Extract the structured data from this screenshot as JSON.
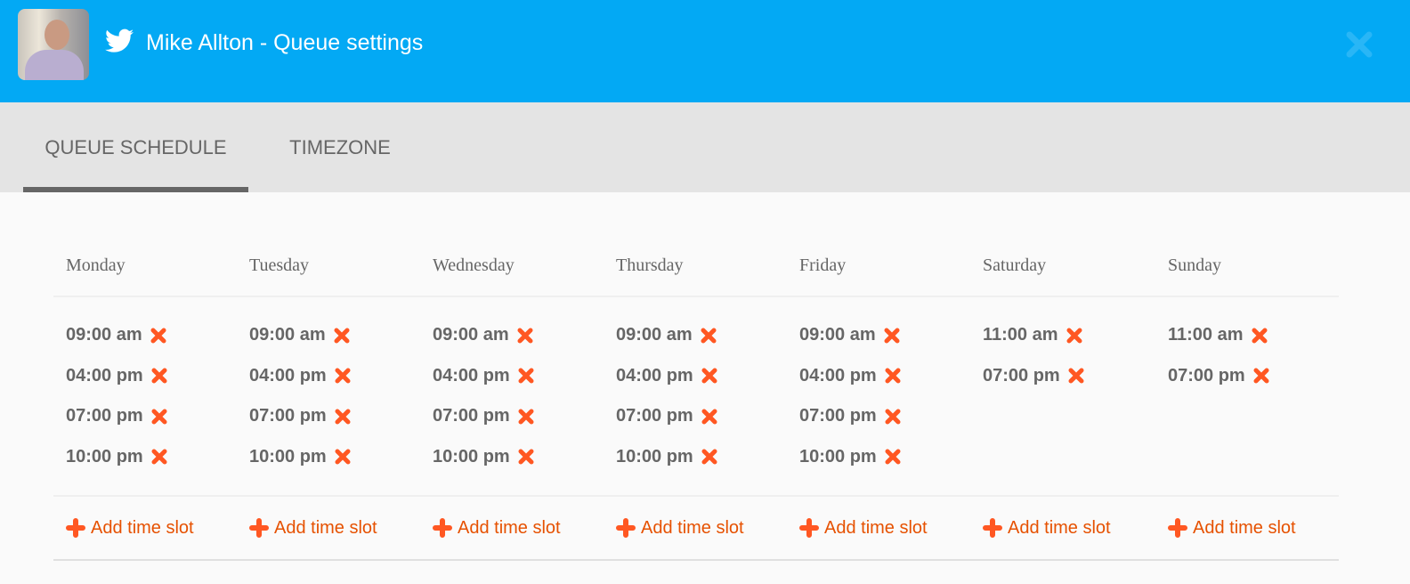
{
  "header": {
    "title": "Mike Allton - Queue settings",
    "icons": {
      "network": "twitter-bird-icon",
      "close": "close-icon"
    },
    "colors": {
      "bg": "#03a9f4"
    }
  },
  "tabs": [
    {
      "label": "QUEUE SCHEDULE",
      "active": true
    },
    {
      "label": "TIMEZONE",
      "active": false
    }
  ],
  "schedule": {
    "days": [
      {
        "name": "Monday",
        "slots": [
          "09:00 am",
          "04:00 pm",
          "07:00 pm",
          "10:00 pm"
        ]
      },
      {
        "name": "Tuesday",
        "slots": [
          "09:00 am",
          "04:00 pm",
          "07:00 pm",
          "10:00 pm"
        ]
      },
      {
        "name": "Wednesday",
        "slots": [
          "09:00 am",
          "04:00 pm",
          "07:00 pm",
          "10:00 pm"
        ]
      },
      {
        "name": "Thursday",
        "slots": [
          "09:00 am",
          "04:00 pm",
          "07:00 pm",
          "10:00 pm"
        ]
      },
      {
        "name": "Friday",
        "slots": [
          "09:00 am",
          "04:00 pm",
          "07:00 pm",
          "10:00 pm"
        ]
      },
      {
        "name": "Saturday",
        "slots": [
          "11:00 am",
          "07:00 pm"
        ]
      },
      {
        "name": "Sunday",
        "slots": [
          "11:00 am",
          "07:00 pm"
        ]
      }
    ],
    "add_label": "Add time slot",
    "colors": {
      "accent": "#ff5722",
      "add_text": "#e65100"
    }
  }
}
